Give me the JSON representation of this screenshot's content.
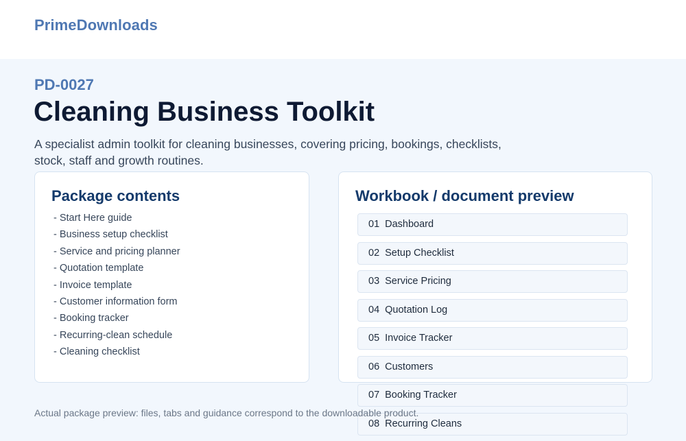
{
  "header": {
    "brand": "PrimeDownloads"
  },
  "product": {
    "code": "PD-0027",
    "title": "Cleaning Business Toolkit",
    "description": "A specialist admin toolkit for cleaning businesses, covering pricing, bookings, checklists, stock, staff and growth routines."
  },
  "contents": {
    "title": "Package contents",
    "items": [
      "- Start Here guide",
      "- Business setup checklist",
      "- Service and pricing planner",
      "- Quotation template",
      "- Invoice template",
      "- Customer information form",
      "- Booking tracker",
      "- Recurring-clean schedule",
      "- Cleaning checklist"
    ]
  },
  "preview": {
    "title": "Workbook / document preview",
    "sheets": [
      {
        "num": "01",
        "label": "Dashboard"
      },
      {
        "num": "02",
        "label": "Setup Checklist"
      },
      {
        "num": "03",
        "label": "Service Pricing"
      },
      {
        "num": "04",
        "label": "Quotation Log"
      },
      {
        "num": "05",
        "label": "Invoice Tracker"
      },
      {
        "num": "06",
        "label": "Customers"
      },
      {
        "num": "07",
        "label": "Booking Tracker"
      },
      {
        "num": "08",
        "label": "Recurring Cleans"
      }
    ]
  },
  "footer": {
    "note": "Actual package preview: files, tabs and guidance correspond to the downloadable product."
  },
  "colors": {
    "brand": "#4f78b3",
    "title": "#0e1a33",
    "heading": "#143a6b",
    "page_background": "#f2f7fd"
  }
}
